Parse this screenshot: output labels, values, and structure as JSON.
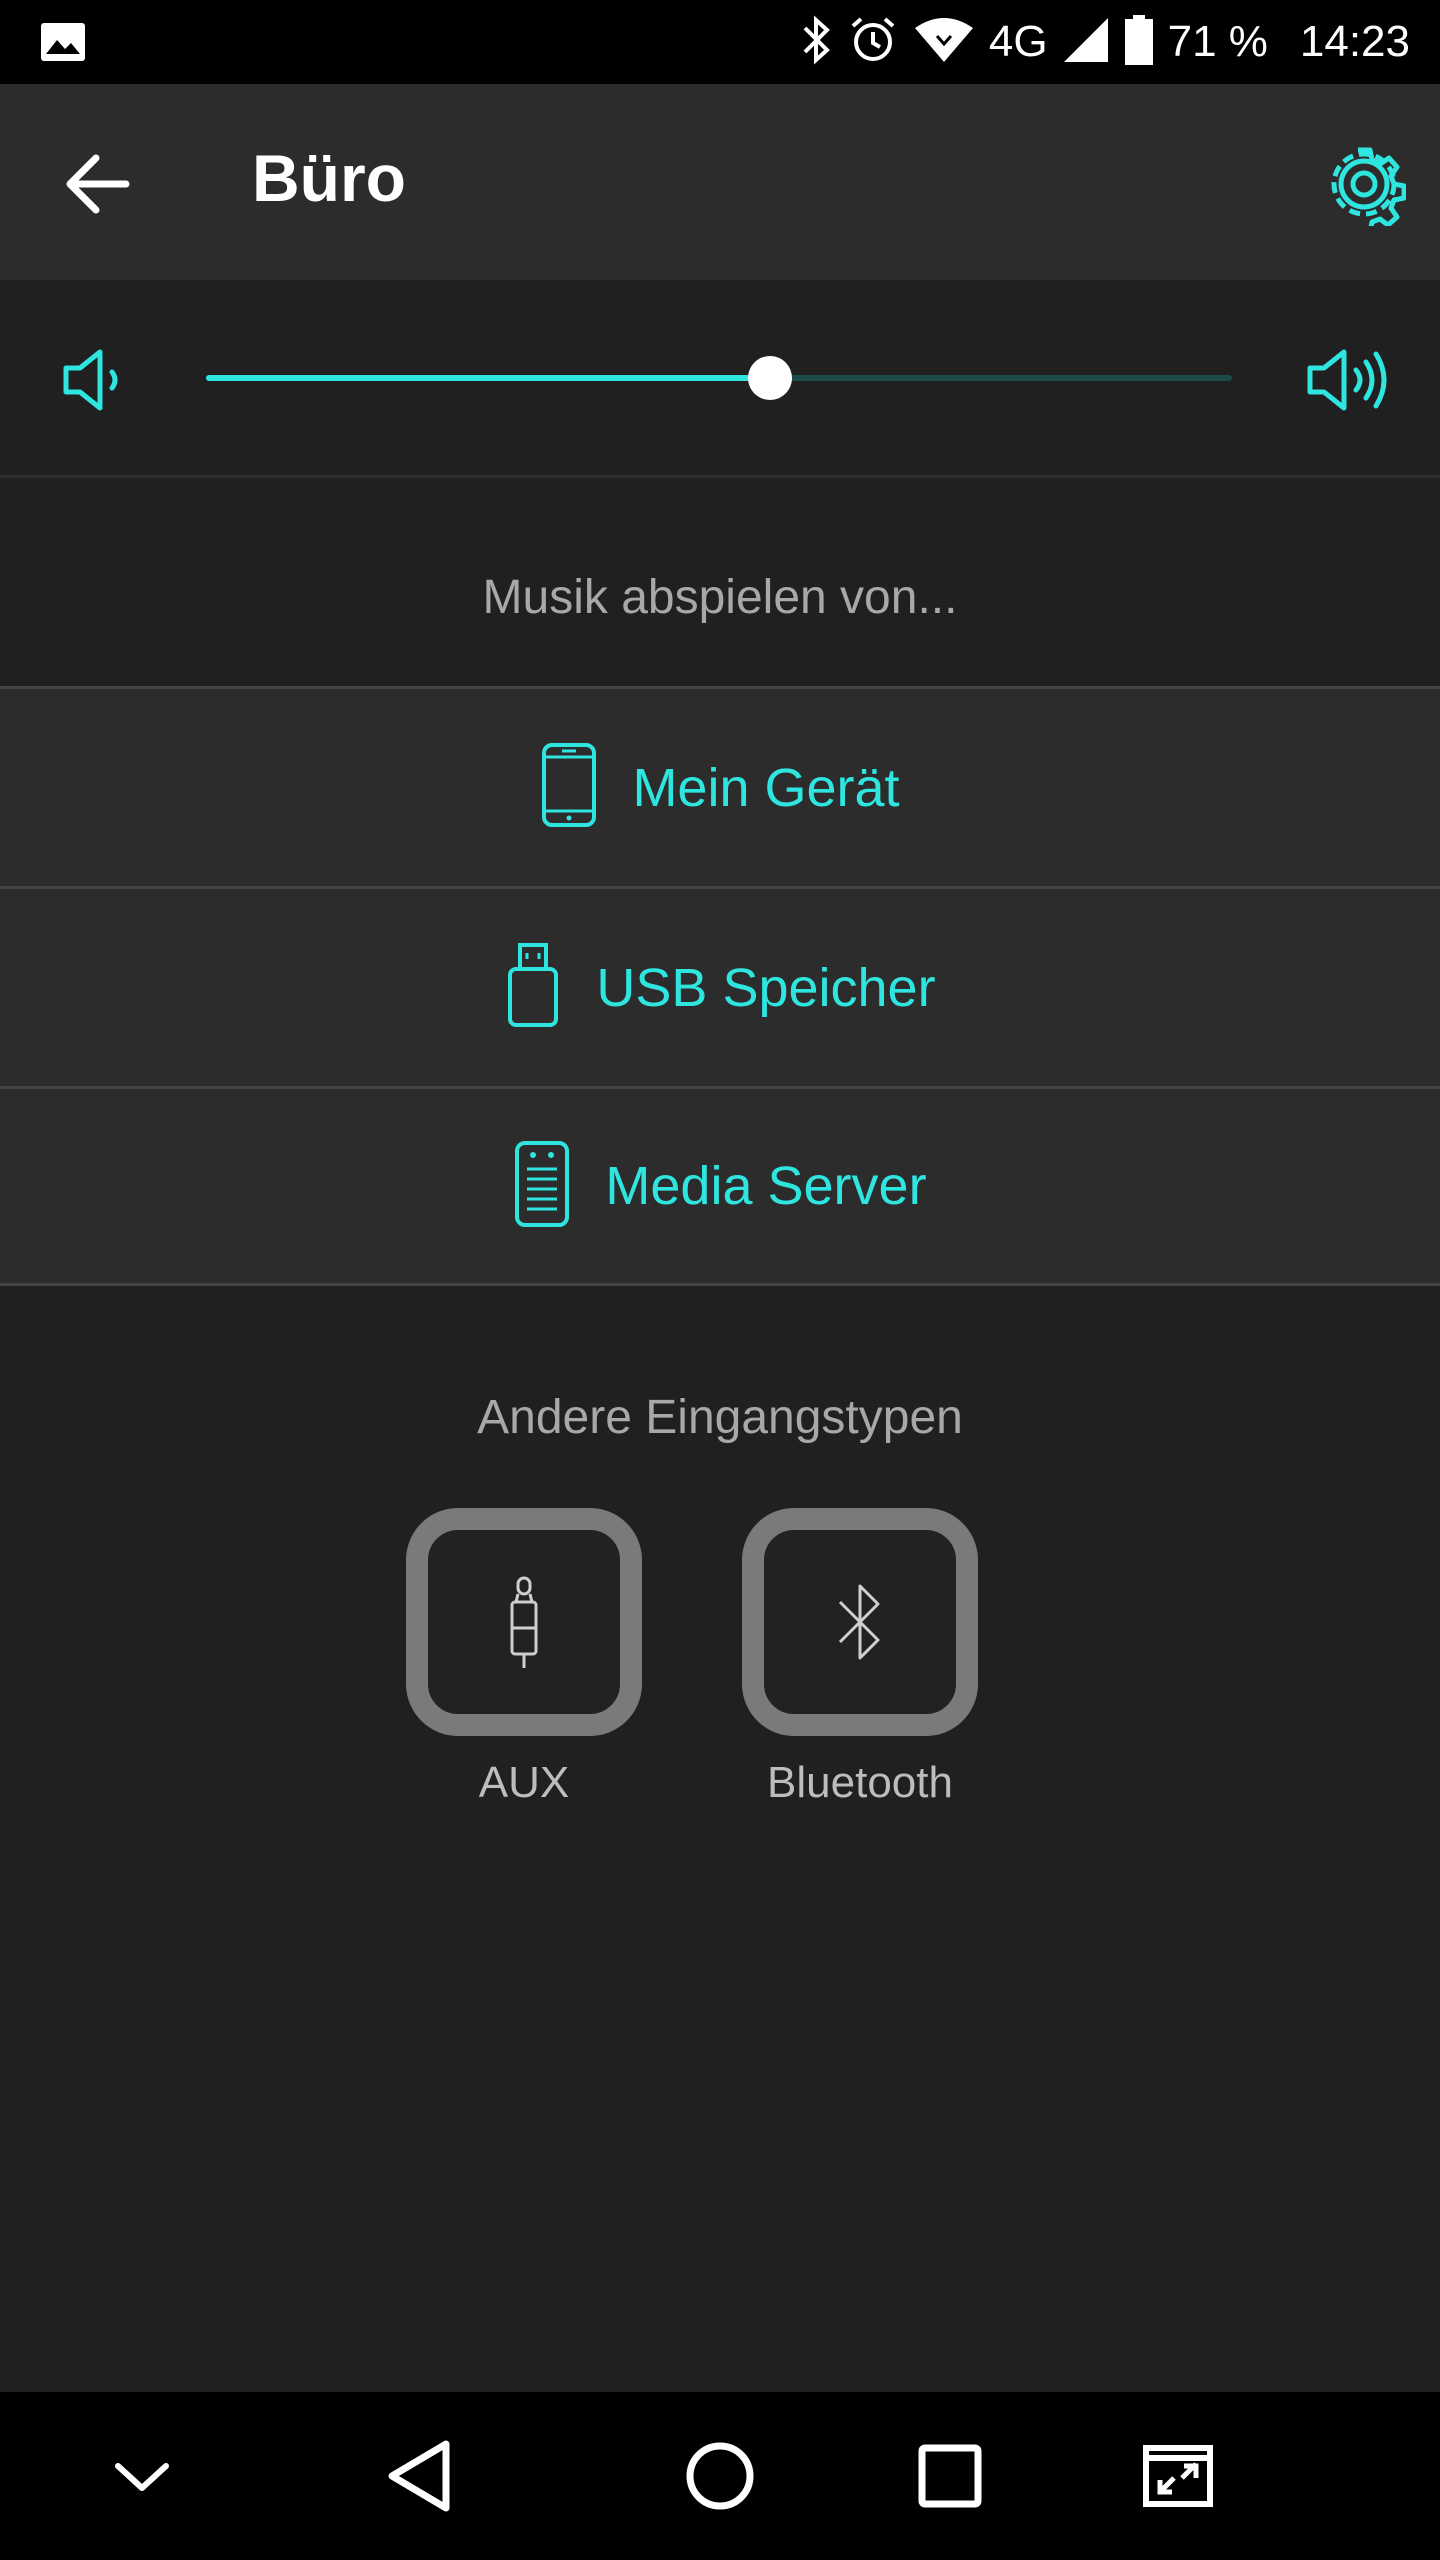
{
  "status_bar": {
    "battery": "71 %",
    "time": "14:23",
    "network": "4G"
  },
  "app_bar": {
    "title": "Büro"
  },
  "volume": {
    "level_percent": 55
  },
  "sources": {
    "heading": "Musik abspielen von...",
    "items": [
      {
        "label": "Mein Gerät",
        "icon": "phone-icon"
      },
      {
        "label": "USB Speicher",
        "icon": "usb-stick-icon"
      },
      {
        "label": "Media Server",
        "icon": "media-server-icon"
      }
    ]
  },
  "other_inputs": {
    "heading": "Andere Eingangstypen",
    "items": [
      {
        "label": "AUX",
        "icon": "aux-plug-icon"
      },
      {
        "label": "Bluetooth",
        "icon": "bluetooth-icon"
      }
    ]
  },
  "colors": {
    "accent": "#2ee5e0",
    "background": "#202020",
    "bar": "#2c2c2c"
  }
}
